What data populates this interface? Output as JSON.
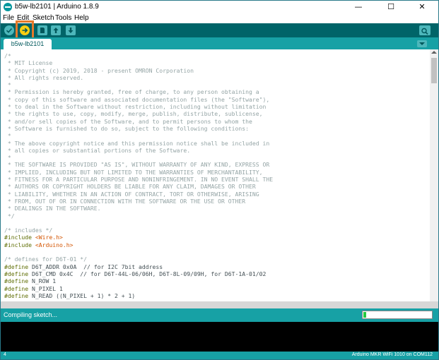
{
  "window": {
    "title": "b5w-lb2101 | Arduino 1.8.9",
    "minimize_glyph": "—",
    "maximize_glyph": "☐",
    "close_glyph": "✕"
  },
  "menu": {
    "items": [
      "File",
      "Edit",
      "Sketch",
      "Tools",
      "Help"
    ]
  },
  "toolbar": {
    "icons": [
      "verify-icon",
      "upload-icon",
      "new-icon",
      "open-icon",
      "save-icon",
      "serial-monitor-icon"
    ],
    "upload_color": "#f7ce11",
    "highlight_color": "#e5792a"
  },
  "tabs": [
    {
      "label": "b5w-lb2101"
    }
  ],
  "editor": {
    "lines": [
      {
        "t": "/*",
        "c": "comment"
      },
      {
        "t": " * MIT License",
        "c": "comment"
      },
      {
        "t": " * Copyright (c) 2019, 2018 - present OMRON Corporation",
        "c": "comment"
      },
      {
        "t": " * All rights reserved.",
        "c": "comment"
      },
      {
        "t": " *",
        "c": "comment"
      },
      {
        "t": " * Permission is hereby granted, free of charge, to any person obtaining a",
        "c": "comment"
      },
      {
        "t": " * copy of this software and associated documentation files (the \"Software\"),",
        "c": "comment"
      },
      {
        "t": " * to deal in the Software without restriction, including without limitation",
        "c": "comment"
      },
      {
        "t": " * the rights to use, copy, modify, merge, publish, distribute, sublicense,",
        "c": "comment"
      },
      {
        "t": " * and/or sell copies of the Software, and to permit persons to whom the",
        "c": "comment"
      },
      {
        "t": " * Software is furnished to do so, subject to the following conditions:",
        "c": "comment"
      },
      {
        "t": " *",
        "c": "comment"
      },
      {
        "t": " * The above copyright notice and this permission notice shall be included in",
        "c": "comment"
      },
      {
        "t": " * all copies or substantial portions of the Software.",
        "c": "comment"
      },
      {
        "t": " *",
        "c": "comment"
      },
      {
        "t": " * THE SOFTWARE IS PROVIDED \"AS IS\", WITHOUT WARRANTY OF ANY KIND, EXPRESS OR",
        "c": "comment"
      },
      {
        "t": " * IMPLIED, INCLUDING BUT NOT LIMITED TO THE WARRANTIES OF MERCHANTABILITY,",
        "c": "comment"
      },
      {
        "t": " * FITNESS FOR A PARTICULAR PURPOSE AND NONINFRINGEMENT. IN NO EVENT SHALL THE",
        "c": "comment"
      },
      {
        "t": " * AUTHORS OR COPYRIGHT HOLDERS BE LIABLE FOR ANY CLAIM, DAMAGES OR OTHER",
        "c": "comment"
      },
      {
        "t": " * LIABILITY, WHETHER IN AN ACTION OF CONTRACT, TORT OR OTHERWISE, ARISING",
        "c": "comment"
      },
      {
        "t": " * FROM, OUT OF OR IN CONNECTION WITH THE SOFTWARE OR THE USE OR OTHER",
        "c": "comment"
      },
      {
        "t": " * DEALINGS IN THE SOFTWARE.",
        "c": "comment"
      },
      {
        "t": " */",
        "c": "comment"
      },
      {
        "t": "",
        "c": "plain"
      },
      {
        "t": "/* includes */",
        "c": "comment"
      },
      {
        "t": "#include <Wire.h>",
        "c": "include",
        "kw": "#include",
        "hdr": "<Wire.h>"
      },
      {
        "t": "#include <Arduino.h>",
        "c": "include",
        "kw": "#include",
        "hdr": "<Arduino.h>"
      },
      {
        "t": "",
        "c": "plain"
      },
      {
        "t": "/* defines for D6T-01 */",
        "c": "comment"
      },
      {
        "t": "#define D6T_ADDR 0x0A  // for I2C 7bit address",
        "c": "define",
        "kw": "#define",
        "rest": " D6T_ADDR 0x0A  // for I2C 7bit address"
      },
      {
        "t": "#define D6T_CMD 0x4C  // for D6T-44L-06/06H, D6T-8L-09/09H, for D6T-1A-01/02",
        "c": "define",
        "kw": "#define",
        "rest": " D6T_CMD 0x4C  // for D6T-44L-06/06H, D6T-8L-09/09H, for D6T-1A-01/02"
      },
      {
        "t": "#define N_ROW 1",
        "c": "define",
        "kw": "#define",
        "rest": " N_ROW 1"
      },
      {
        "t": "#define N_PIXEL 1",
        "c": "define",
        "kw": "#define",
        "rest": " N_PIXEL 1"
      },
      {
        "t": "#define N_READ ((N_PIXEL + 1) * 2 + 1)",
        "c": "define",
        "kw": "#define",
        "rest": " N_READ ((N_PIXEL + 1) * 2 + 1)"
      }
    ]
  },
  "status": {
    "message": "Compiling sketch...",
    "progress_fraction": 0.04
  },
  "footer": {
    "line_number": "4",
    "board_port": "Arduino MKR WiFi 1010 on COM112"
  }
}
